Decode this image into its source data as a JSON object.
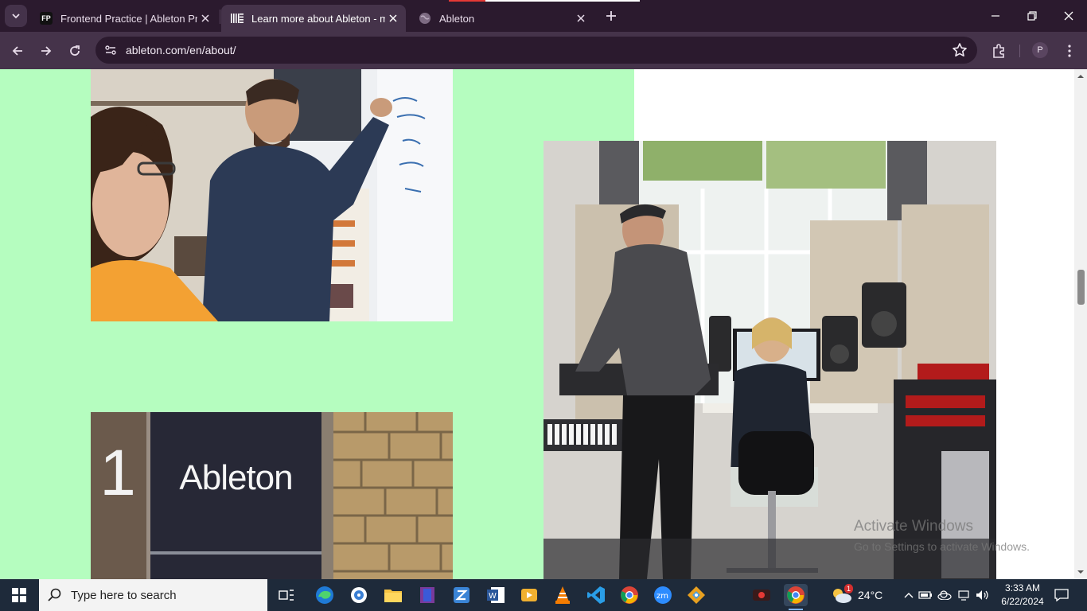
{
  "browser": {
    "tabs": [
      {
        "title": "Frontend Practice | Ableton Project",
        "favicon_text": "FP",
        "active": false
      },
      {
        "title": "Learn more about Ableton - make music",
        "favicon_text": "",
        "active": true
      },
      {
        "title": "Ableton",
        "favicon_text": "",
        "active": false
      }
    ],
    "address": "ableton.com/en/about/",
    "profile_initial": "P"
  },
  "page": {
    "sign_text": "Ableton",
    "sign_number": "1",
    "colors": {
      "green": "#b5fdbf",
      "white": "#ffffff"
    }
  },
  "watermark": {
    "line1": "Activate Windows",
    "line2": "Go to Settings to activate Windows."
  },
  "taskbar": {
    "search_placeholder": "Type here to search",
    "weather_temp": "24°C",
    "weather_badge": "1",
    "time": "3:33 AM",
    "date": "6/22/2024",
    "apps": [
      "task-view",
      "edge",
      "media-player",
      "file-explorer",
      "winrar",
      "zotero",
      "word",
      "video-editor",
      "vlc",
      "vscode",
      "chrome",
      "zoom",
      "git"
    ]
  }
}
